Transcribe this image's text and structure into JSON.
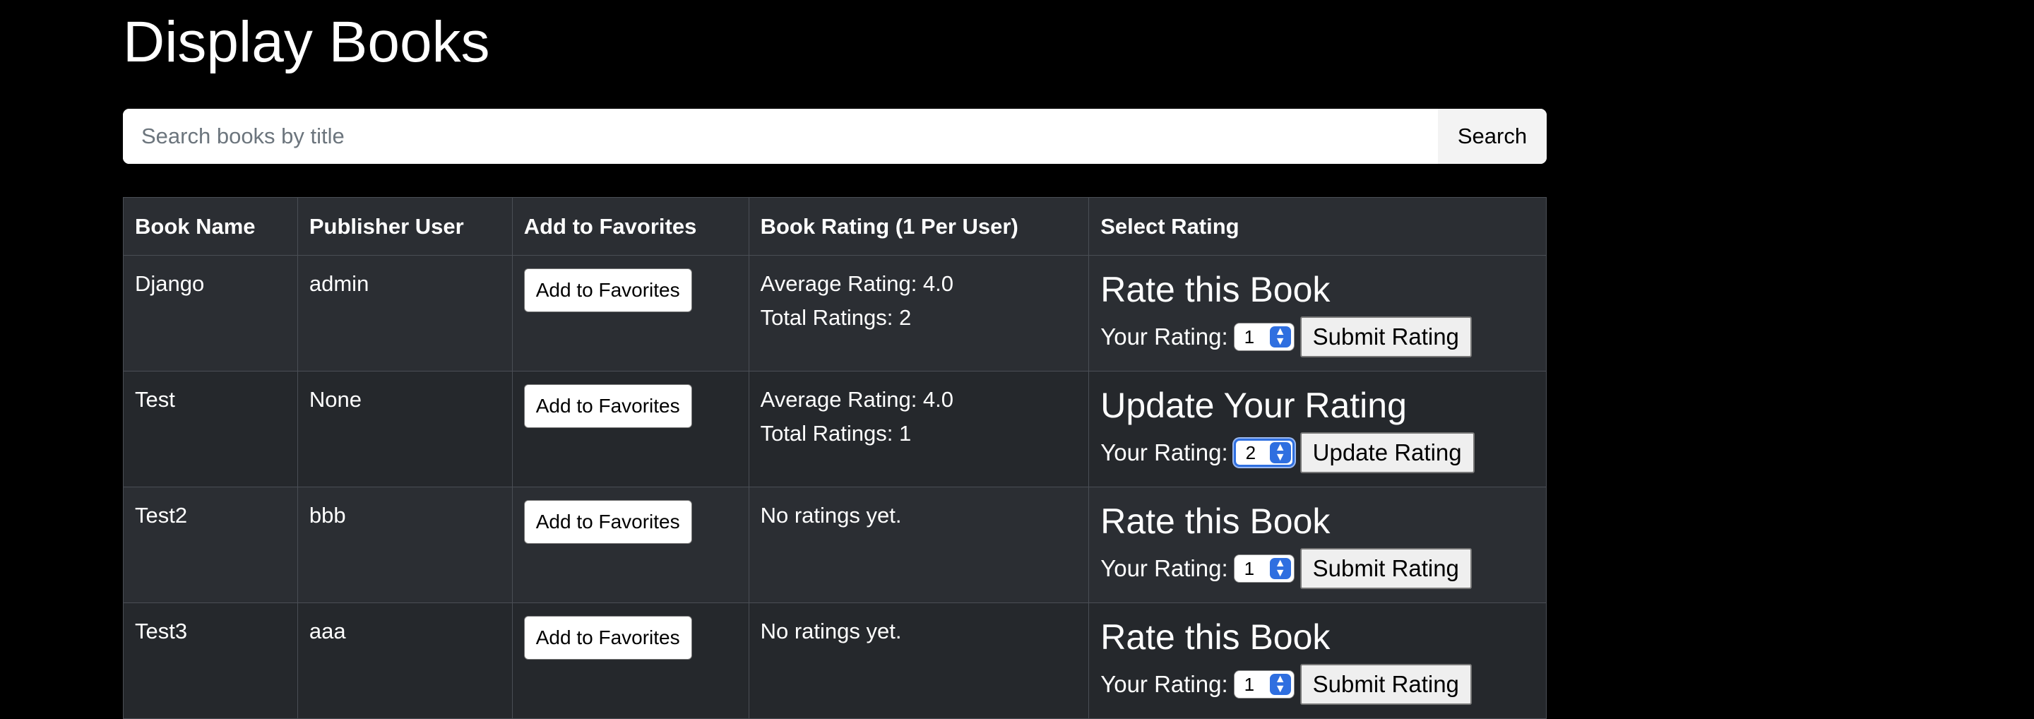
{
  "page": {
    "title": "Display Books"
  },
  "search": {
    "placeholder": "Search books by title",
    "value": "",
    "button_label": "Search"
  },
  "table": {
    "headers": [
      "Book Name",
      "Publisher User",
      "Add to Favorites",
      "Book Rating (1 Per User)",
      "Select Rating"
    ],
    "rows": [
      {
        "name": "Django",
        "publisher": "admin",
        "fav_label": "Add to Favorites",
        "avg": "Average Rating: 4.0",
        "total": "Total Ratings: 2",
        "heading": "Rate this Book",
        "your_rating_label": "Your Rating:",
        "selected": "1",
        "action": "Submit Rating"
      },
      {
        "name": "Test",
        "publisher": "None",
        "fav_label": "Add to Favorites",
        "avg": "Average Rating: 4.0",
        "total": "Total Ratings: 1",
        "heading": "Update Your Rating",
        "your_rating_label": "Your Rating:",
        "selected": "2",
        "action": "Update Rating"
      },
      {
        "name": "Test2",
        "publisher": "bbb",
        "fav_label": "Add to Favorites",
        "avg": "No ratings yet.",
        "total": "",
        "heading": "Rate this Book",
        "your_rating_label": "Your Rating:",
        "selected": "1",
        "action": "Submit Rating"
      },
      {
        "name": "Test3",
        "publisher": "aaa",
        "fav_label": "Add to Favorites",
        "avg": "No ratings yet.",
        "total": "",
        "heading": "Rate this Book",
        "your_rating_label": "Your Rating:",
        "selected": "1",
        "action": "Submit Rating"
      }
    ]
  },
  "icons": {
    "select_arrow": "chevron-up-down-icon"
  },
  "colors": {
    "background": "#000000",
    "table_bg": "#2b2e33",
    "select_accent": "#2f6fe0"
  }
}
